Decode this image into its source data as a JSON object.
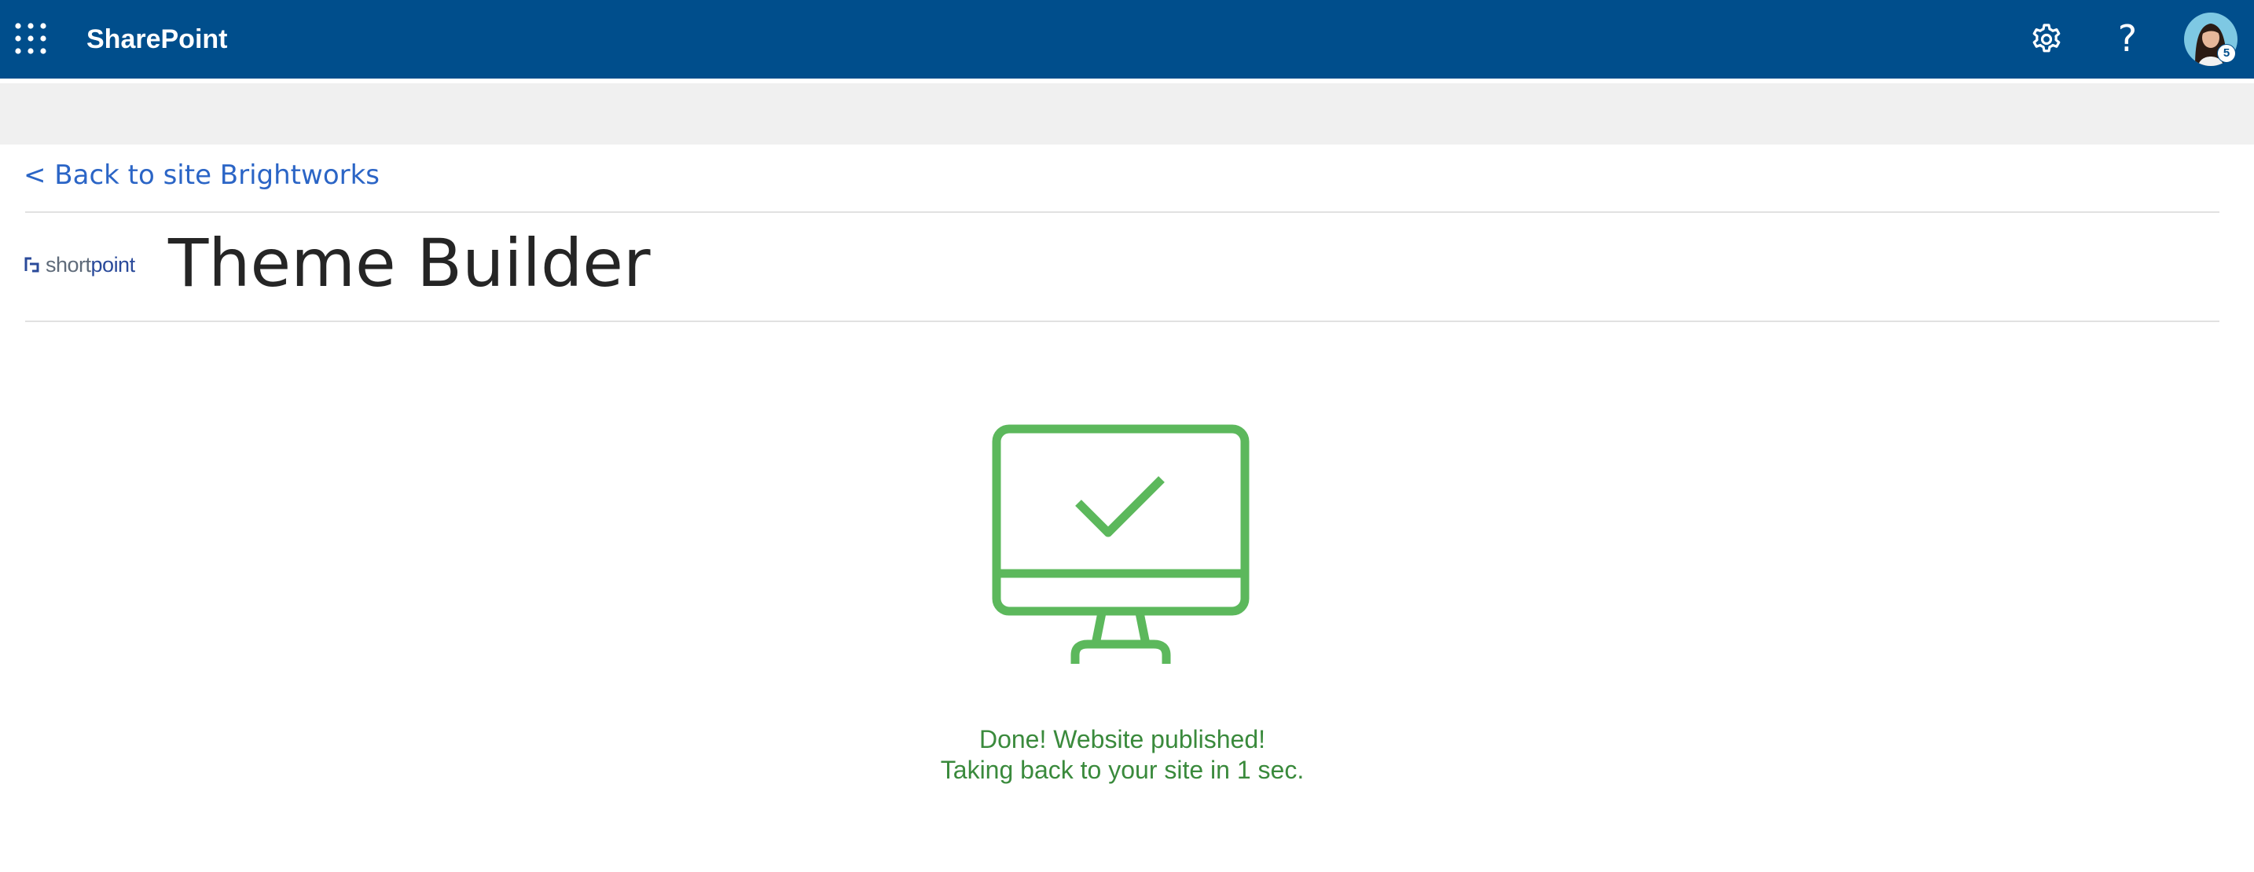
{
  "suitebar": {
    "app_title": "SharePoint",
    "launcher_icon": "waffle-icon",
    "settings_icon": "gear-icon",
    "help_label": "?",
    "avatar_badge": "5",
    "background_color": "#004e8c"
  },
  "nav": {
    "back_link": "< Back to site Brightworks"
  },
  "header": {
    "logo_text_light": "short",
    "logo_text_bold": "point",
    "title": "Theme Builder"
  },
  "main": {
    "status_icon": "monitor-check-icon",
    "status_line1": "Done! Website published!",
    "status_line2": "Taking back to your site in 1 sec.",
    "accent_color": "#5cb85c"
  }
}
